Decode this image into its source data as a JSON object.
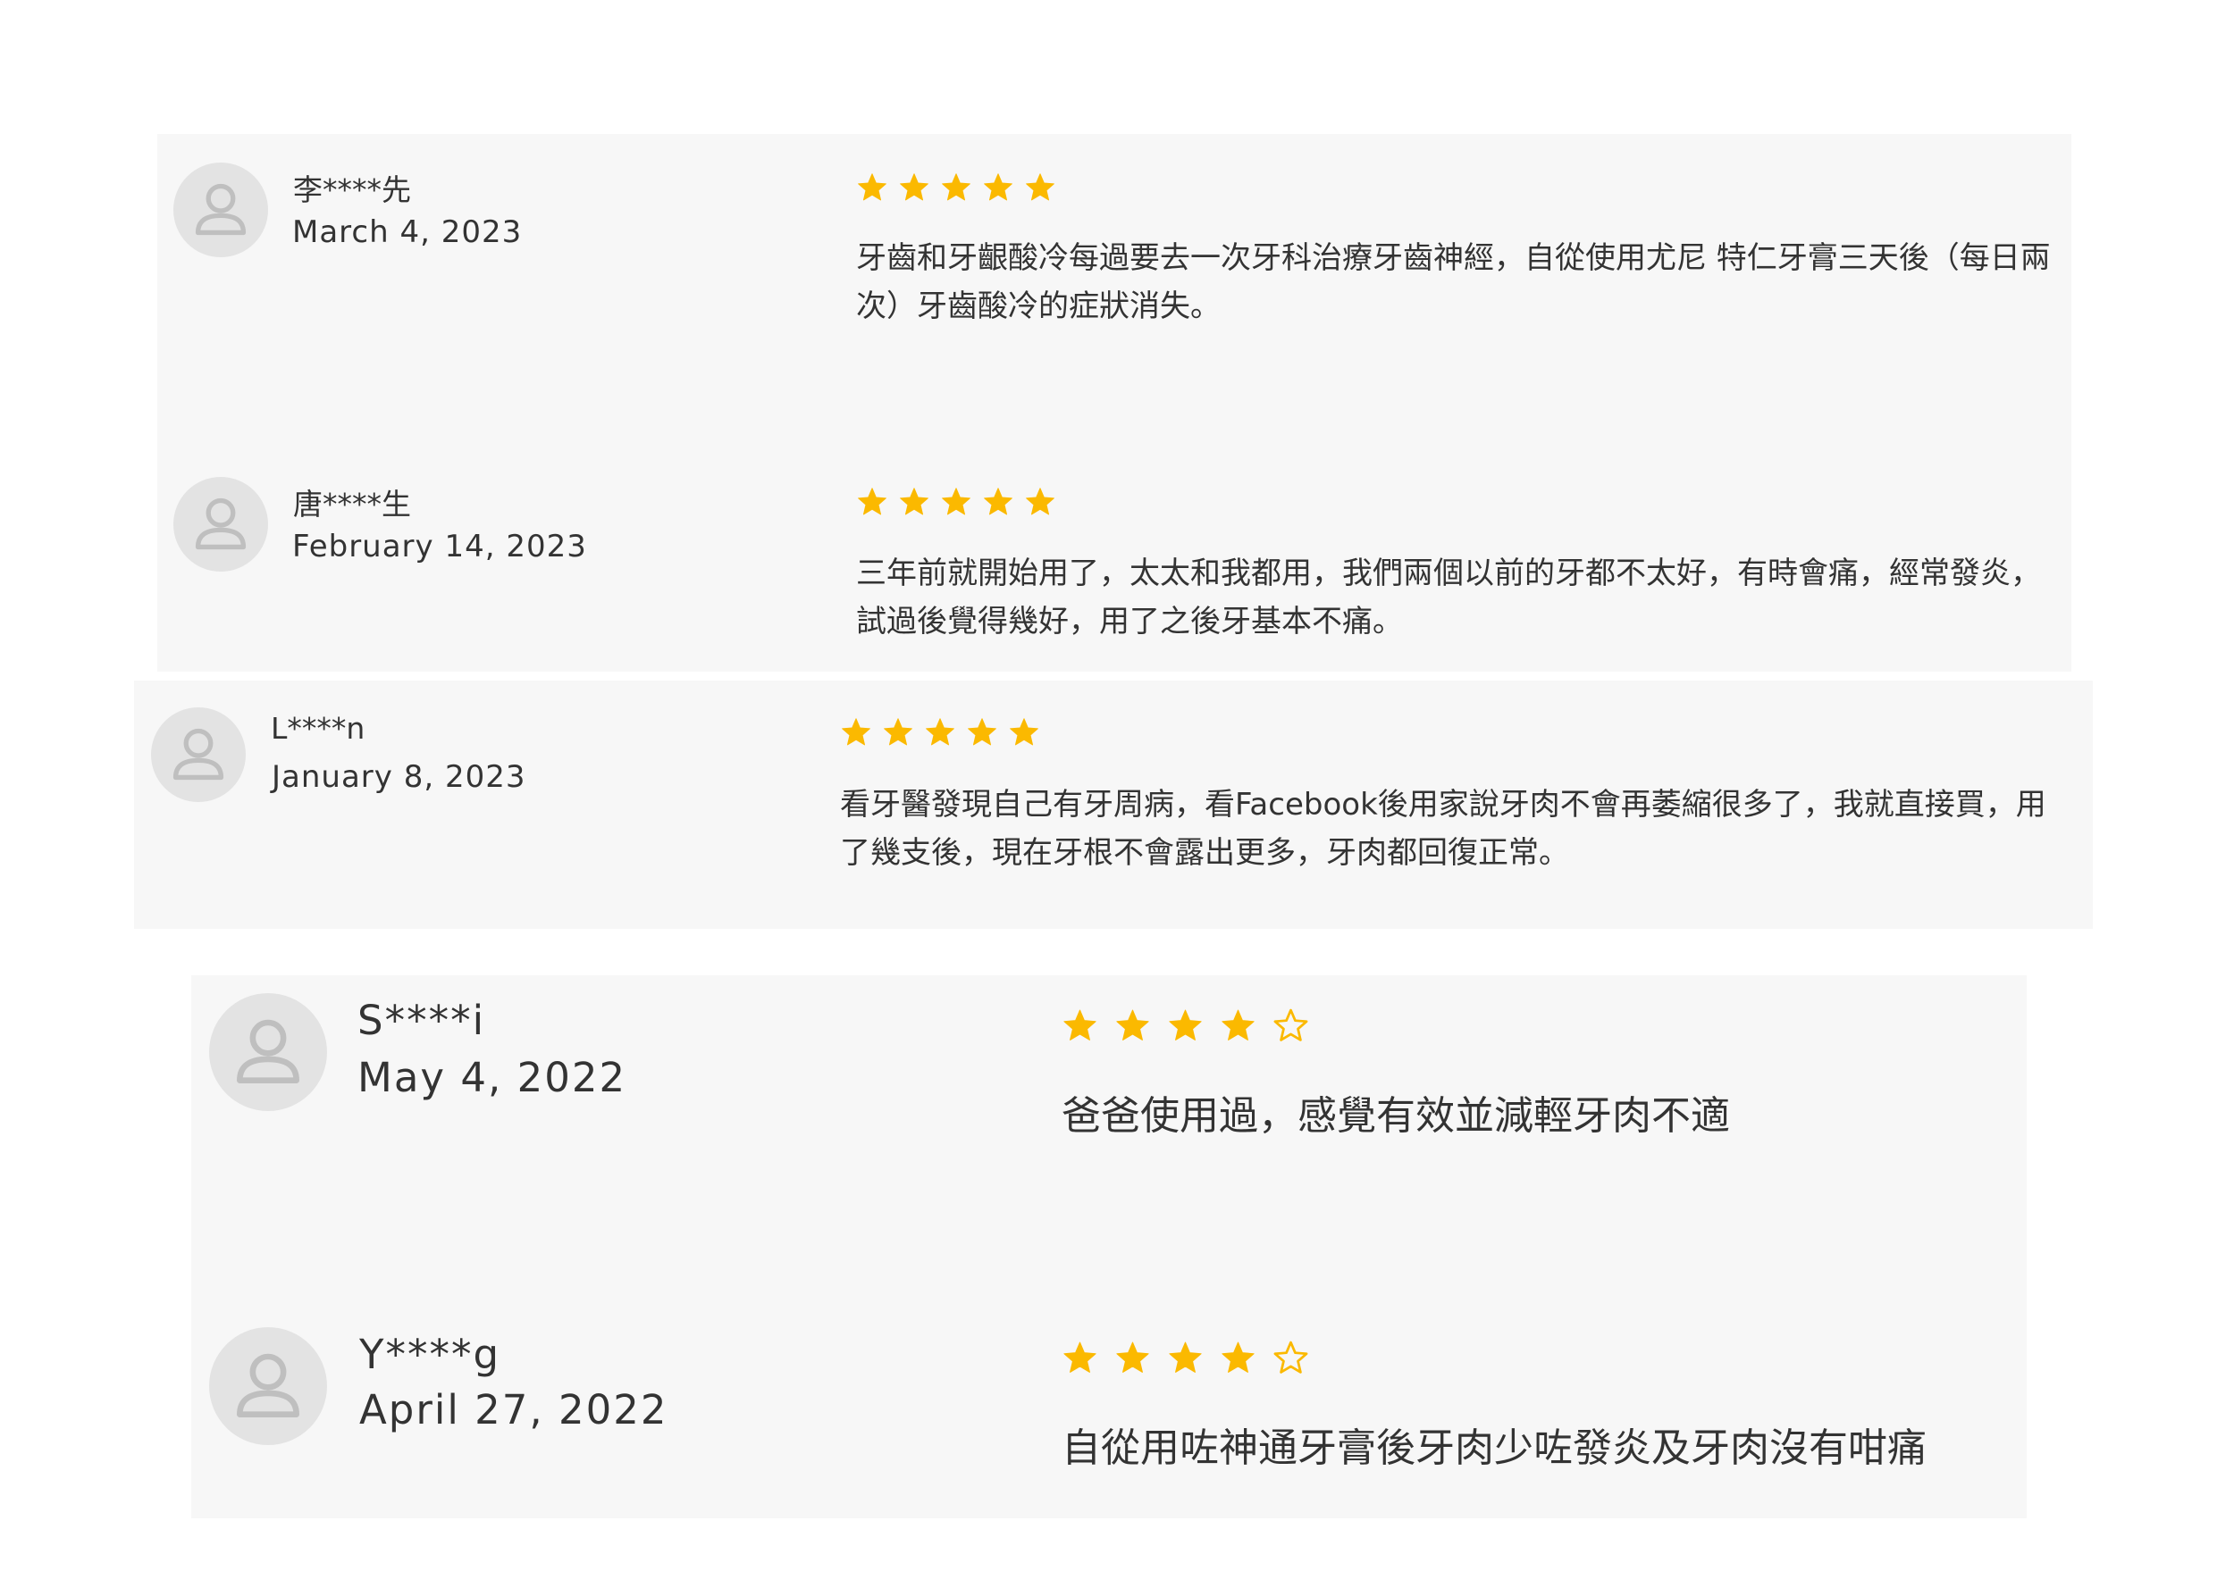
{
  "colors": {
    "star_filled": "#fbb900",
    "star_empty_outline": "#fbb900",
    "avatar_bg": "#e3e3e3",
    "avatar_glyph": "#bfbfbf",
    "panel_bg": "#f7f7f7",
    "text": "#333333"
  },
  "reviews": [
    {
      "name": "李****先",
      "date": "March 4, 2023",
      "rating": 5,
      "max_rating": 5,
      "text": "牙齒和牙齦酸冷每過要去一次牙科治療牙齒神經，自從使用尤尼 特仁牙膏三天後（每日兩次）牙齒酸冷的症狀消失。",
      "avatar_icon": "user-avatar-icon"
    },
    {
      "name": "唐****生",
      "date": "February 14, 2023",
      "rating": 5,
      "max_rating": 5,
      "text": "三年前就開始用了，太太和我都用，我們兩個以前的牙都不太好，有時會痛，經常發炎，試過後覺得幾好，用了之後牙基本不痛。",
      "avatar_icon": "user-avatar-icon"
    },
    {
      "name": "L****n",
      "date": "January 8, 2023",
      "rating": 5,
      "max_rating": 5,
      "text": "看牙醫發現自己有牙周病，看Facebook後用家說牙肉不會再萎縮很多了，我就直接買，用了幾支後，現在牙根不會露出更多，牙肉都回復正常。",
      "avatar_icon": "user-avatar-icon"
    },
    {
      "name": "S****i",
      "date": "May 4, 2022",
      "rating": 4,
      "max_rating": 5,
      "text": "爸爸使用過，感覺有效並減輕牙肉不適",
      "avatar_icon": "user-avatar-icon"
    },
    {
      "name": "Y****g",
      "date": "April 27, 2022",
      "rating": 4,
      "max_rating": 5,
      "text": "自從用咗神通牙膏後牙肉少咗發炎及牙肉沒有咁痛",
      "avatar_icon": "user-avatar-icon"
    }
  ]
}
